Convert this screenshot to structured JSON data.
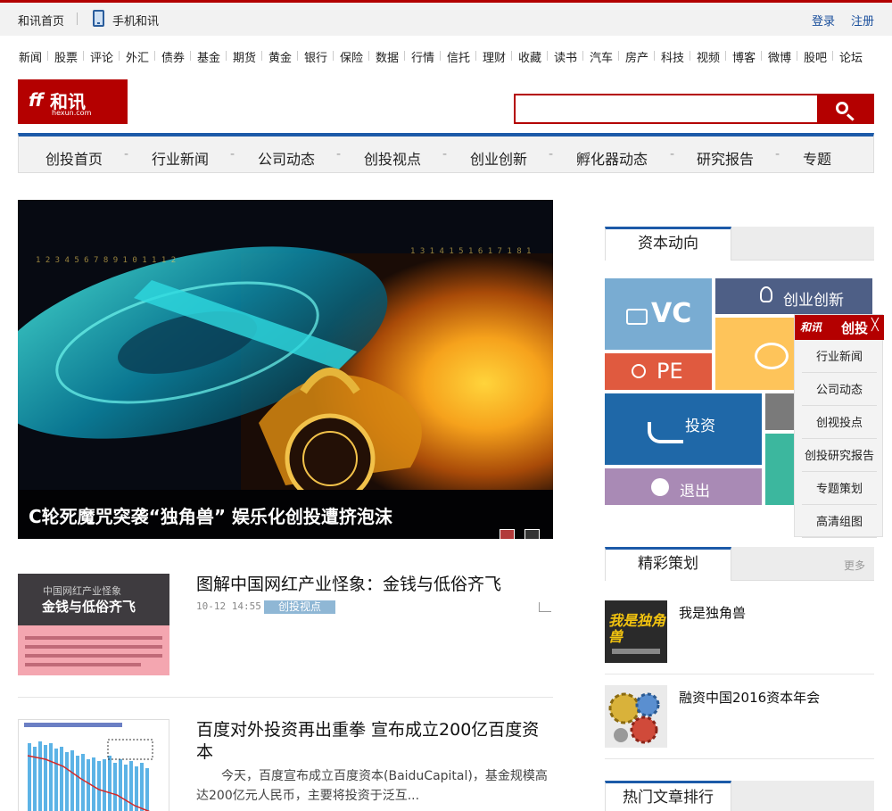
{
  "topbar": {
    "home": "和讯首页",
    "mobile": "手机和讯",
    "login": "登录",
    "register": "注册"
  },
  "channels": [
    "新闻",
    "股票",
    "评论",
    "外汇",
    "债券",
    "基金",
    "期货",
    "黄金",
    "银行",
    "保险",
    "数据",
    "行情",
    "信托",
    "理财",
    "收藏",
    "读书",
    "汽车",
    "房产",
    "科技",
    "视频",
    "博客",
    "微博",
    "股吧",
    "论坛"
  ],
  "logo": {
    "text": "和讯",
    "domain": "hexun.com"
  },
  "search": {
    "value": ""
  },
  "mainnav": [
    "创投首页",
    "行业新闻",
    "公司动态",
    "创投视点",
    "创业创新",
    "孵化器动态",
    "研究报告",
    "专题"
  ],
  "mainnav_separator": "-",
  "hero": {
    "caption": "C轮死魔咒突袭“独角兽” 娱乐化创投遭挤泡沫"
  },
  "articles": [
    {
      "title": "图解中国网红产业怪象：金钱与低俗齐飞",
      "time": "10-12 14:55",
      "tag": "创投视点",
      "thumb": {
        "line1": "中国网红产业怪象",
        "line2": "金钱与低俗齐飞"
      }
    },
    {
      "title": "百度对外投资再出重拳 宣布成立200亿百度资本",
      "summary": "今天，百度宣布成立百度资本(BaiduCapital)，基金规模高达200亿元人民币，主要将投资于泛互..."
    }
  ],
  "capital": {
    "tab": "资本动向",
    "tiles": {
      "vc": "VC",
      "pe": "PE",
      "innovation": "创业创新",
      "invest": "投资",
      "exit": "退出"
    }
  },
  "float_panel": {
    "head_logo": "和讯",
    "head_title": "创投",
    "close": "╳",
    "items": [
      "行业新闻",
      "公司动态",
      "创视投点",
      "创投研究报告",
      "专题策划",
      "高清组图"
    ]
  },
  "specials": {
    "tab": "精彩策划",
    "more": "更多",
    "items": [
      {
        "title": "我是独角兽",
        "thumb_text": "我是独角兽"
      },
      {
        "title": "融资中国2016资本年会"
      }
    ]
  },
  "hot": {
    "tab": "热门文章排行"
  },
  "colors": {
    "brand_red": "#b40000",
    "nav_blue": "#1c5aa8",
    "tile_vc": "#79acd2",
    "tile_pe": "#e05a3f",
    "tile_innovation": "#4e5f86",
    "tile_yellow": "#fec45a",
    "tile_invest": "#1f68a8",
    "tile_exit": "#a98ab5",
    "tile_teal": "#3cb79e",
    "tile_gray": "#7a7a7a"
  }
}
